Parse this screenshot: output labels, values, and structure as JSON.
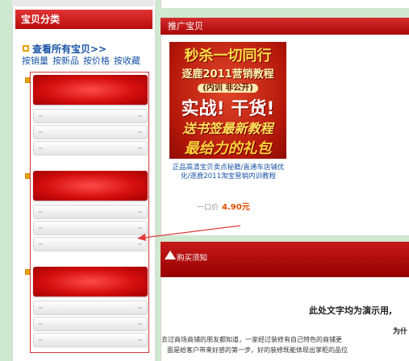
{
  "sidebar": {
    "header": "宝贝分类",
    "view_all": "查看所有宝贝>>",
    "sort_links": [
      "按销量",
      "按新品",
      "按价格",
      "按收藏"
    ]
  },
  "promo": {
    "header": "推广宝贝",
    "image_text": {
      "line1": "秒杀一切同行",
      "line2": "逐鹿2011营销教程",
      "line3": "(内训 非公开)",
      "line4": "实战! 干货!",
      "line5": "送书签最新教程",
      "line6": "最给力的礼包"
    },
    "product_title": "正品高清宝贝卖点秘籍/直通车店铺优化/逐鹿2011淘宝营销内训教程",
    "price_label": "一口价",
    "price": "4.90元"
  },
  "notice": {
    "header": "购买须知",
    "demo_text": "此处文字均为演示用,",
    "sub_heading": "为什",
    "body_line1": "去过商场商铺的朋友都知道，一家经过装修有自己特色的商铺更",
    "body_line2": "面是给客户带来好感的第一步，好的装修既能体现出掌柜的品位"
  },
  "colors": {
    "background": "#cfe8d0",
    "header_red": "#c41010",
    "link_blue": "#1a54a6",
    "price_orange": "#e14b00",
    "annotation_red": "#d23a3a"
  }
}
